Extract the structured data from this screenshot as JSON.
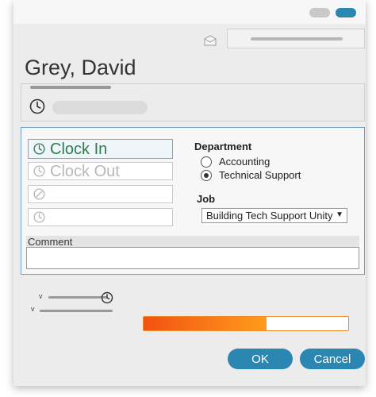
{
  "employee": {
    "name": "Grey, David"
  },
  "actions": {
    "clock_in": "Clock In",
    "clock_out": "Clock Out"
  },
  "department": {
    "title": "Department",
    "options": [
      "Accounting",
      "Technical Support"
    ],
    "selected": "Technical Support"
  },
  "job": {
    "title": "Job",
    "selected": "Building Tech Support Unity",
    "arrow": "▼"
  },
  "comment": {
    "label": "Comment",
    "value": ""
  },
  "tree": {
    "expand_glyph": "v"
  },
  "progress": {
    "percent": 60
  },
  "buttons": {
    "ok": "OK",
    "cancel": "Cancel"
  },
  "colors": {
    "accent": "#2b86b1",
    "clock_in_text": "#2e7d4e",
    "progress_start": "#f25212",
    "progress_end": "#ff9c1c"
  },
  "icons": {
    "mail": "mail-icon",
    "clock": "clock-icon",
    "break": "no-entry-icon"
  }
}
